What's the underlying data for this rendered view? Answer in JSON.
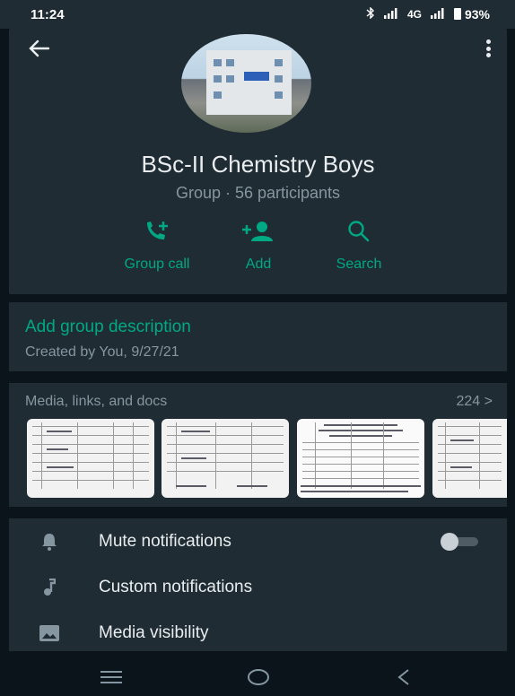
{
  "status_bar": {
    "time": "11:24",
    "network_text": "4G",
    "battery": "93%"
  },
  "header": {
    "title": "BSc-II Chemistry Boys",
    "subtitle": "Group · 56 participants",
    "avatar_icon": "group-photo-building",
    "actions": [
      {
        "label": "Group call",
        "icon": "add-call-icon"
      },
      {
        "label": "Add",
        "icon": "add-person-icon"
      },
      {
        "label": "Search",
        "icon": "search-icon"
      }
    ],
    "accent": "#00a884"
  },
  "description": {
    "title": "Add group description",
    "created": "Created by You, 9/27/21"
  },
  "media": {
    "title": "Media, links, and docs",
    "count": "224",
    "chevron": ">"
  },
  "settings": {
    "items": [
      {
        "label": "Mute notifications",
        "icon": "bell-icon",
        "toggle_on": false
      },
      {
        "label": "Custom notifications",
        "icon": "music-note-icon"
      },
      {
        "label": "Media visibility",
        "icon": "image-icon"
      }
    ]
  },
  "nav": {
    "buttons": [
      "menu-icon",
      "home-icon",
      "back-icon"
    ]
  },
  "colors": {
    "background": "#0b141a",
    "card": "#1f2c34",
    "text_primary": "#e9edef",
    "text_secondary": "#8696a0"
  }
}
